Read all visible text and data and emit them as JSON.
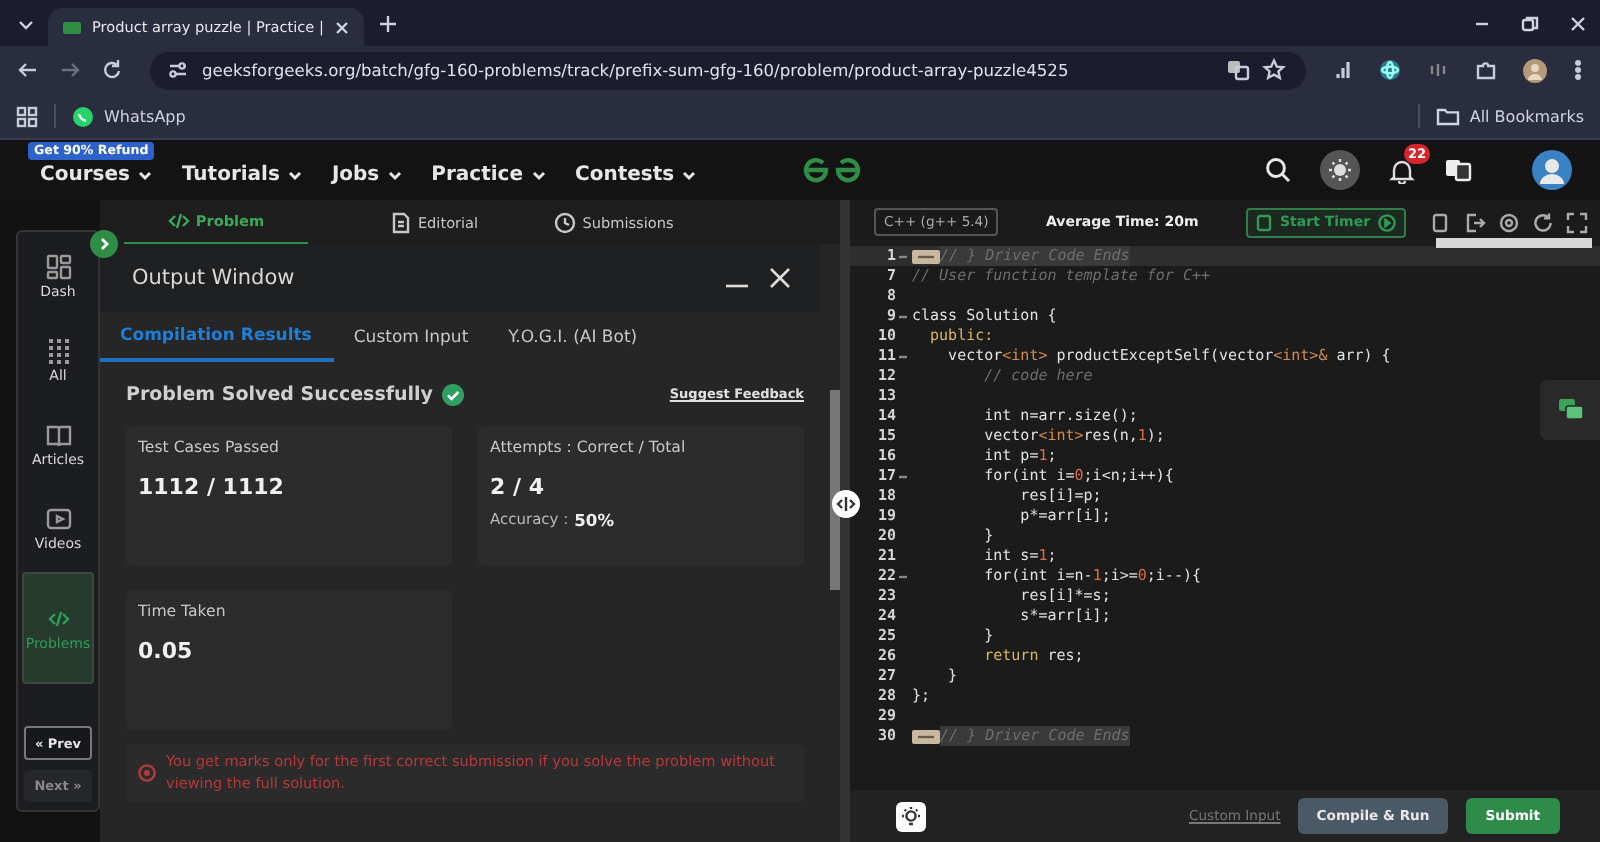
{
  "browser": {
    "tab_title": "Product array puzzle | Practice |",
    "url": "geeksforgeeks.org/batch/gfg-160-problems/track/prefix-sum-gfg-160/problem/product-array-puzzle4525",
    "bookmarks": [
      {
        "label": "WhatsApp"
      }
    ],
    "all_bookmarks": "All Bookmarks"
  },
  "nav": {
    "badge": "Get 90% Refund",
    "items": [
      "Courses",
      "Tutorials",
      "Jobs",
      "Practice",
      "Contests"
    ],
    "notification_count": "22"
  },
  "sidebar": {
    "items": [
      {
        "label": "Dash",
        "selected": false
      },
      {
        "label": "All",
        "selected": false
      },
      {
        "label": "Articles",
        "selected": false
      },
      {
        "label": "Videos",
        "selected": false
      },
      {
        "label": "Problems",
        "selected": true
      }
    ],
    "prev": "« Prev",
    "next": "Next »"
  },
  "problem_tabs": [
    {
      "label": "Problem",
      "selected": true
    },
    {
      "label": "Editorial",
      "selected": false
    },
    {
      "label": "Submissions",
      "selected": false
    }
  ],
  "output_window": {
    "title": "Output Window",
    "tabs": [
      {
        "label": "Compilation Results",
        "selected": true
      },
      {
        "label": "Custom Input",
        "selected": false
      },
      {
        "label": "Y.O.G.I. (AI Bot)",
        "selected": false
      }
    ],
    "status": "Problem Solved Successfully",
    "feedback_link": "Suggest Feedback",
    "cards": [
      {
        "label": "Test Cases Passed",
        "value": "1112 / 1112"
      },
      {
        "label": "Attempts : Correct / Total",
        "value": "2 / 4",
        "detail_label": "Accuracy :",
        "detail_value": "50%"
      },
      {
        "label": "Time Taken",
        "value": "0.05"
      }
    ],
    "notice": "You get marks only for the first correct submission if you solve the problem without viewing the full solution."
  },
  "editor": {
    "language": "C++ (g++ 5.4)",
    "average_time": "Average Time: 20m",
    "timer_button": "Start Timer",
    "lines": [
      {
        "number": "1",
        "fold": true,
        "active": true,
        "marker": true,
        "tokens": [
          {
            "kind": "comment",
            "text": "// } Driver Code Ends"
          }
        ]
      },
      {
        "number": "7",
        "fold": false,
        "active": false,
        "marker": false,
        "tokens": [
          {
            "kind": "comment",
            "text": "// User function template for C++"
          }
        ]
      },
      {
        "number": "8",
        "fold": false,
        "active": false,
        "marker": false
      },
      {
        "number": "9",
        "fold": true,
        "active": false,
        "marker": false,
        "tokens": [
          {
            "kind": "plain",
            "text": "class Solution {"
          }
        ]
      },
      {
        "number": "10",
        "fold": false,
        "active": false,
        "marker": false,
        "tokens": [
          {
            "kind": "keyword",
            "text": "  public:"
          }
        ]
      },
      {
        "number": "11",
        "fold": true,
        "active": false,
        "marker": false,
        "tokens": [
          {
            "kind": "plain",
            "text": "    vector"
          },
          {
            "kind": "type",
            "text": "<int>"
          },
          {
            "kind": "plain",
            "text": " productExceptSelf(vector"
          },
          {
            "kind": "type",
            "text": "<int>&"
          },
          {
            "kind": "plain",
            "text": " arr) {"
          }
        ]
      },
      {
        "number": "12",
        "fold": false,
        "active": false,
        "marker": false,
        "tokens": [
          {
            "kind": "comment",
            "text": "        // code here"
          }
        ]
      },
      {
        "number": "13",
        "fold": false,
        "active": false,
        "marker": false
      },
      {
        "number": "14",
        "fold": false,
        "active": false,
        "marker": false,
        "tokens": [
          {
            "kind": "plain",
            "text": "        int n=arr.size();"
          }
        ]
      },
      {
        "number": "15",
        "fold": false,
        "active": false,
        "marker": false,
        "tokens": [
          {
            "kind": "plain",
            "text": "        vector"
          },
          {
            "kind": "type",
            "text": "<int>"
          },
          {
            "kind": "plain",
            "text": "res(n,"
          },
          {
            "kind": "number",
            "text": "1"
          },
          {
            "kind": "plain",
            "text": ");"
          }
        ]
      },
      {
        "number": "16",
        "fold": false,
        "active": false,
        "marker": false,
        "tokens": [
          {
            "kind": "plain",
            "text": "        int p="
          },
          {
            "kind": "number",
            "text": "1"
          },
          {
            "kind": "plain",
            "text": ";"
          }
        ]
      },
      {
        "number": "17",
        "fold": true,
        "active": false,
        "marker": false,
        "tokens": [
          {
            "kind": "plain",
            "text": "        for(int i="
          },
          {
            "kind": "number",
            "text": "0"
          },
          {
            "kind": "plain",
            "text": ";i<n;i++){"
          }
        ]
      },
      {
        "number": "18",
        "fold": false,
        "active": false,
        "marker": false,
        "tokens": [
          {
            "kind": "plain",
            "text": "            res[i]=p;"
          }
        ]
      },
      {
        "number": "19",
        "fold": false,
        "active": false,
        "marker": false,
        "tokens": [
          {
            "kind": "plain",
            "text": "            p*=arr[i];"
          }
        ]
      },
      {
        "number": "20",
        "fold": false,
        "active": false,
        "marker": false,
        "tokens": [
          {
            "kind": "plain",
            "text": "        }"
          }
        ]
      },
      {
        "number": "21",
        "fold": false,
        "active": false,
        "marker": false,
        "tokens": [
          {
            "kind": "plain",
            "text": "        int s="
          },
          {
            "kind": "number",
            "text": "1"
          },
          {
            "kind": "plain",
            "text": ";"
          }
        ]
      },
      {
        "number": "22",
        "fold": true,
        "active": false,
        "marker": false,
        "tokens": [
          {
            "kind": "plain",
            "text": "        for(int i=n-"
          },
          {
            "kind": "number",
            "text": "1"
          },
          {
            "kind": "plain",
            "text": ";i>="
          },
          {
            "kind": "number",
            "text": "0"
          },
          {
            "kind": "plain",
            "text": ";i--){"
          }
        ]
      },
      {
        "number": "23",
        "fold": false,
        "active": false,
        "marker": false,
        "tokens": [
          {
            "kind": "plain",
            "text": "            res[i]*=s;"
          }
        ]
      },
      {
        "number": "24",
        "fold": false,
        "active": false,
        "marker": false,
        "tokens": [
          {
            "kind": "plain",
            "text": "            s*=arr[i];"
          }
        ]
      },
      {
        "number": "25",
        "fold": false,
        "active": false,
        "marker": false,
        "tokens": [
          {
            "kind": "plain",
            "text": "        }"
          }
        ]
      },
      {
        "number": "26",
        "fold": false,
        "active": false,
        "marker": false,
        "tokens": [
          {
            "kind": "keyword",
            "text": "        return"
          },
          {
            "kind": "plain",
            "text": " res;"
          }
        ]
      },
      {
        "number": "27",
        "fold": false,
        "active": false,
        "marker": false,
        "tokens": [
          {
            "kind": "plain",
            "text": "    }"
          }
        ]
      },
      {
        "number": "28",
        "fold": false,
        "active": false,
        "marker": false,
        "tokens": [
          {
            "kind": "plain",
            "text": "};"
          }
        ]
      },
      {
        "number": "29",
        "fold": false,
        "active": false,
        "marker": false
      },
      {
        "number": "30",
        "fold": false,
        "active": false,
        "marker": true,
        "tokens": [
          {
            "kind": "comment",
            "text": "// } Driver Code Ends"
          }
        ]
      }
    ],
    "custom_input": "Custom Input",
    "compile_button": "Compile & Run",
    "submit_button": "Submit"
  }
}
